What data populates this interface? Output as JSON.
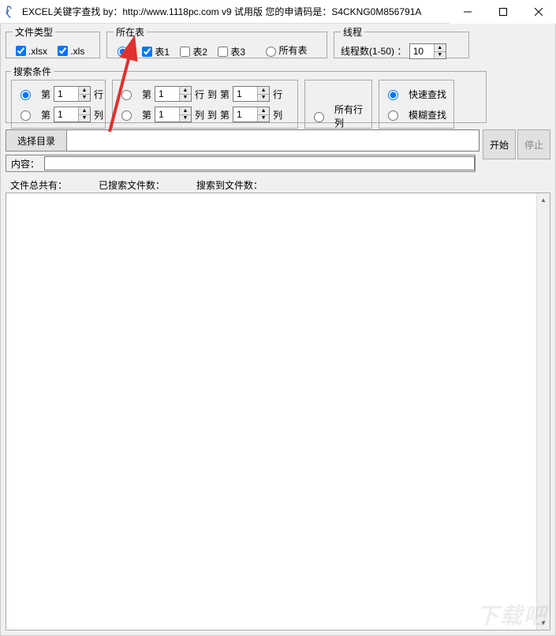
{
  "window": {
    "title": "EXCEL关键字查找  by：http://www.1118pc.com v9 试用版 您的申请码是：S4CKNG0M856791A"
  },
  "groups": {
    "filetype": {
      "legend": "文件类型",
      "xlsx": ".xlsx",
      "xls": ".xls"
    },
    "sheet": {
      "legend": "所在表",
      "radio_specify": "",
      "s1": "表1",
      "s2": "表2",
      "s3": "表3",
      "all": "所有表"
    },
    "threads": {
      "legend": "线程",
      "label": "线程数(1-50) ：",
      "value": "10"
    },
    "cond": {
      "legend": "搜索条件",
      "di": "第",
      "row": "行",
      "col": "列",
      "to": "到",
      "v1": "1",
      "v2": "1",
      "v3": "1",
      "v4": "1",
      "v5": "1",
      "v6": "1",
      "all_cols": "所有行列",
      "fast": "快速查找",
      "fuzzy": "模糊查找"
    }
  },
  "dirrow": {
    "choose": "选择目录",
    "path": "",
    "start": "开始",
    "stop": "停止"
  },
  "contentrow": {
    "label": "内容：",
    "value": ""
  },
  "status": {
    "total": "文件总共有：",
    "searched": "已搜索文件数：",
    "found": "搜索到文件数："
  },
  "watermark": "下载吧"
}
